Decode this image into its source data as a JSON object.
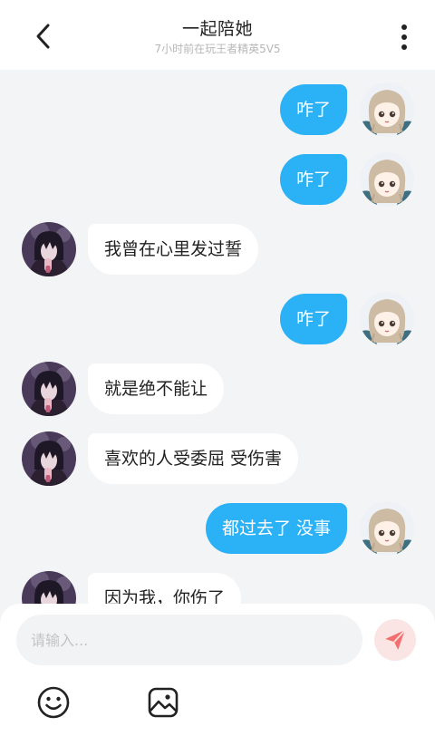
{
  "header": {
    "title": "一起陪她",
    "subtitle": "7小时前在玩王者精英5V5",
    "back_icon": "chevron-left-icon",
    "more_icon": "more-vertical-icon"
  },
  "messages": [
    {
      "side": "mine",
      "text": "咋了"
    },
    {
      "side": "mine",
      "text": "咋了"
    },
    {
      "side": "theirs",
      "text": "我曾在心里发过誓"
    },
    {
      "side": "mine",
      "text": "咋了"
    },
    {
      "side": "theirs",
      "text": "就是绝不能让"
    },
    {
      "side": "theirs",
      "text": "喜欢的人受委屈 受伤害"
    },
    {
      "side": "mine",
      "text": "都过去了 没事"
    },
    {
      "side": "theirs",
      "text": "因为我，你伤了"
    }
  ],
  "composer": {
    "placeholder": "请输入...",
    "send_icon": "send-icon",
    "emoji_icon": "smiley-icon",
    "image_icon": "image-icon"
  },
  "colors": {
    "accent": "#2bb1f5",
    "send_button_bg": "#fbe4e4",
    "send_icon": "#f46f6f"
  }
}
